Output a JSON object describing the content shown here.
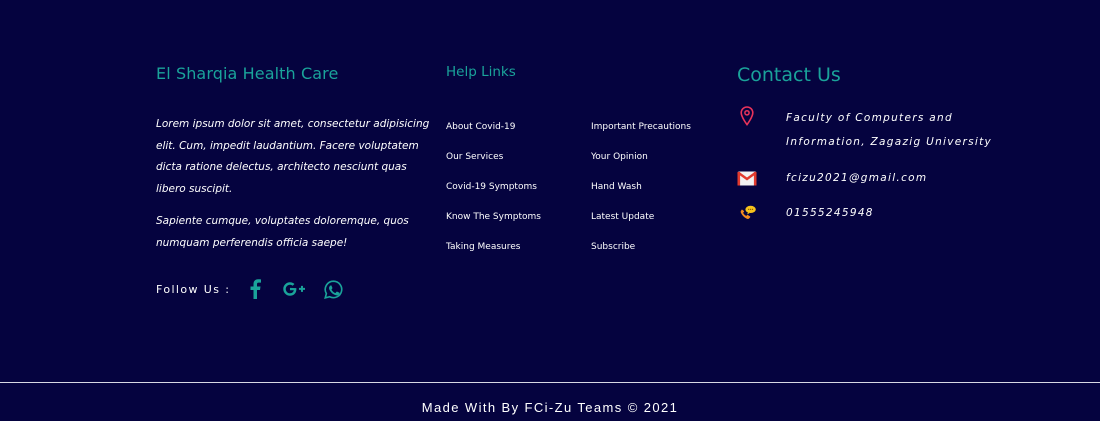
{
  "about": {
    "brand": "El Sharqia Health Care",
    "paragraph1": "Lorem ipsum dolor sit amet, consectetur adipisicing elit. Cum, impedit laudantium. Facere voluptatem dicta ratione delectus, architecto nesciunt quas libero suscipit.",
    "paragraph2": "Sapiente cumque, voluptates doloremque, quos numquam perferendis officia saepe!",
    "follow_label": "Follow Us :",
    "social_icons": [
      "facebook-icon",
      "google-plus-icon",
      "whatsapp-icon"
    ]
  },
  "help": {
    "title": "Help Links",
    "column1": [
      "About Covid-19",
      "Our Services",
      "Covid-19 Symptoms",
      "Know The Symptoms",
      "Taking Measures"
    ],
    "column2": [
      "Important Precautions",
      "Your Opinion",
      "Hand Wash",
      "Latest Update",
      "Subscribe"
    ]
  },
  "contact": {
    "title": "Contact Us",
    "address": "Faculty of Computers and Information, Zagazig University",
    "email": "fcizu2021@gmail.com",
    "phone": "01555245948",
    "icons": [
      "location-pin-icon",
      "mail-icon",
      "phone-icon"
    ]
  },
  "bottom": {
    "copyright": "Made With By FCi-Zu Teams © 2021"
  },
  "colors": {
    "background": "#05033f",
    "accent": "#1aa39a",
    "text": "#ffffff",
    "pin": "#e8335a",
    "mail": "#e23b2e",
    "phone": "#f58a1f"
  }
}
